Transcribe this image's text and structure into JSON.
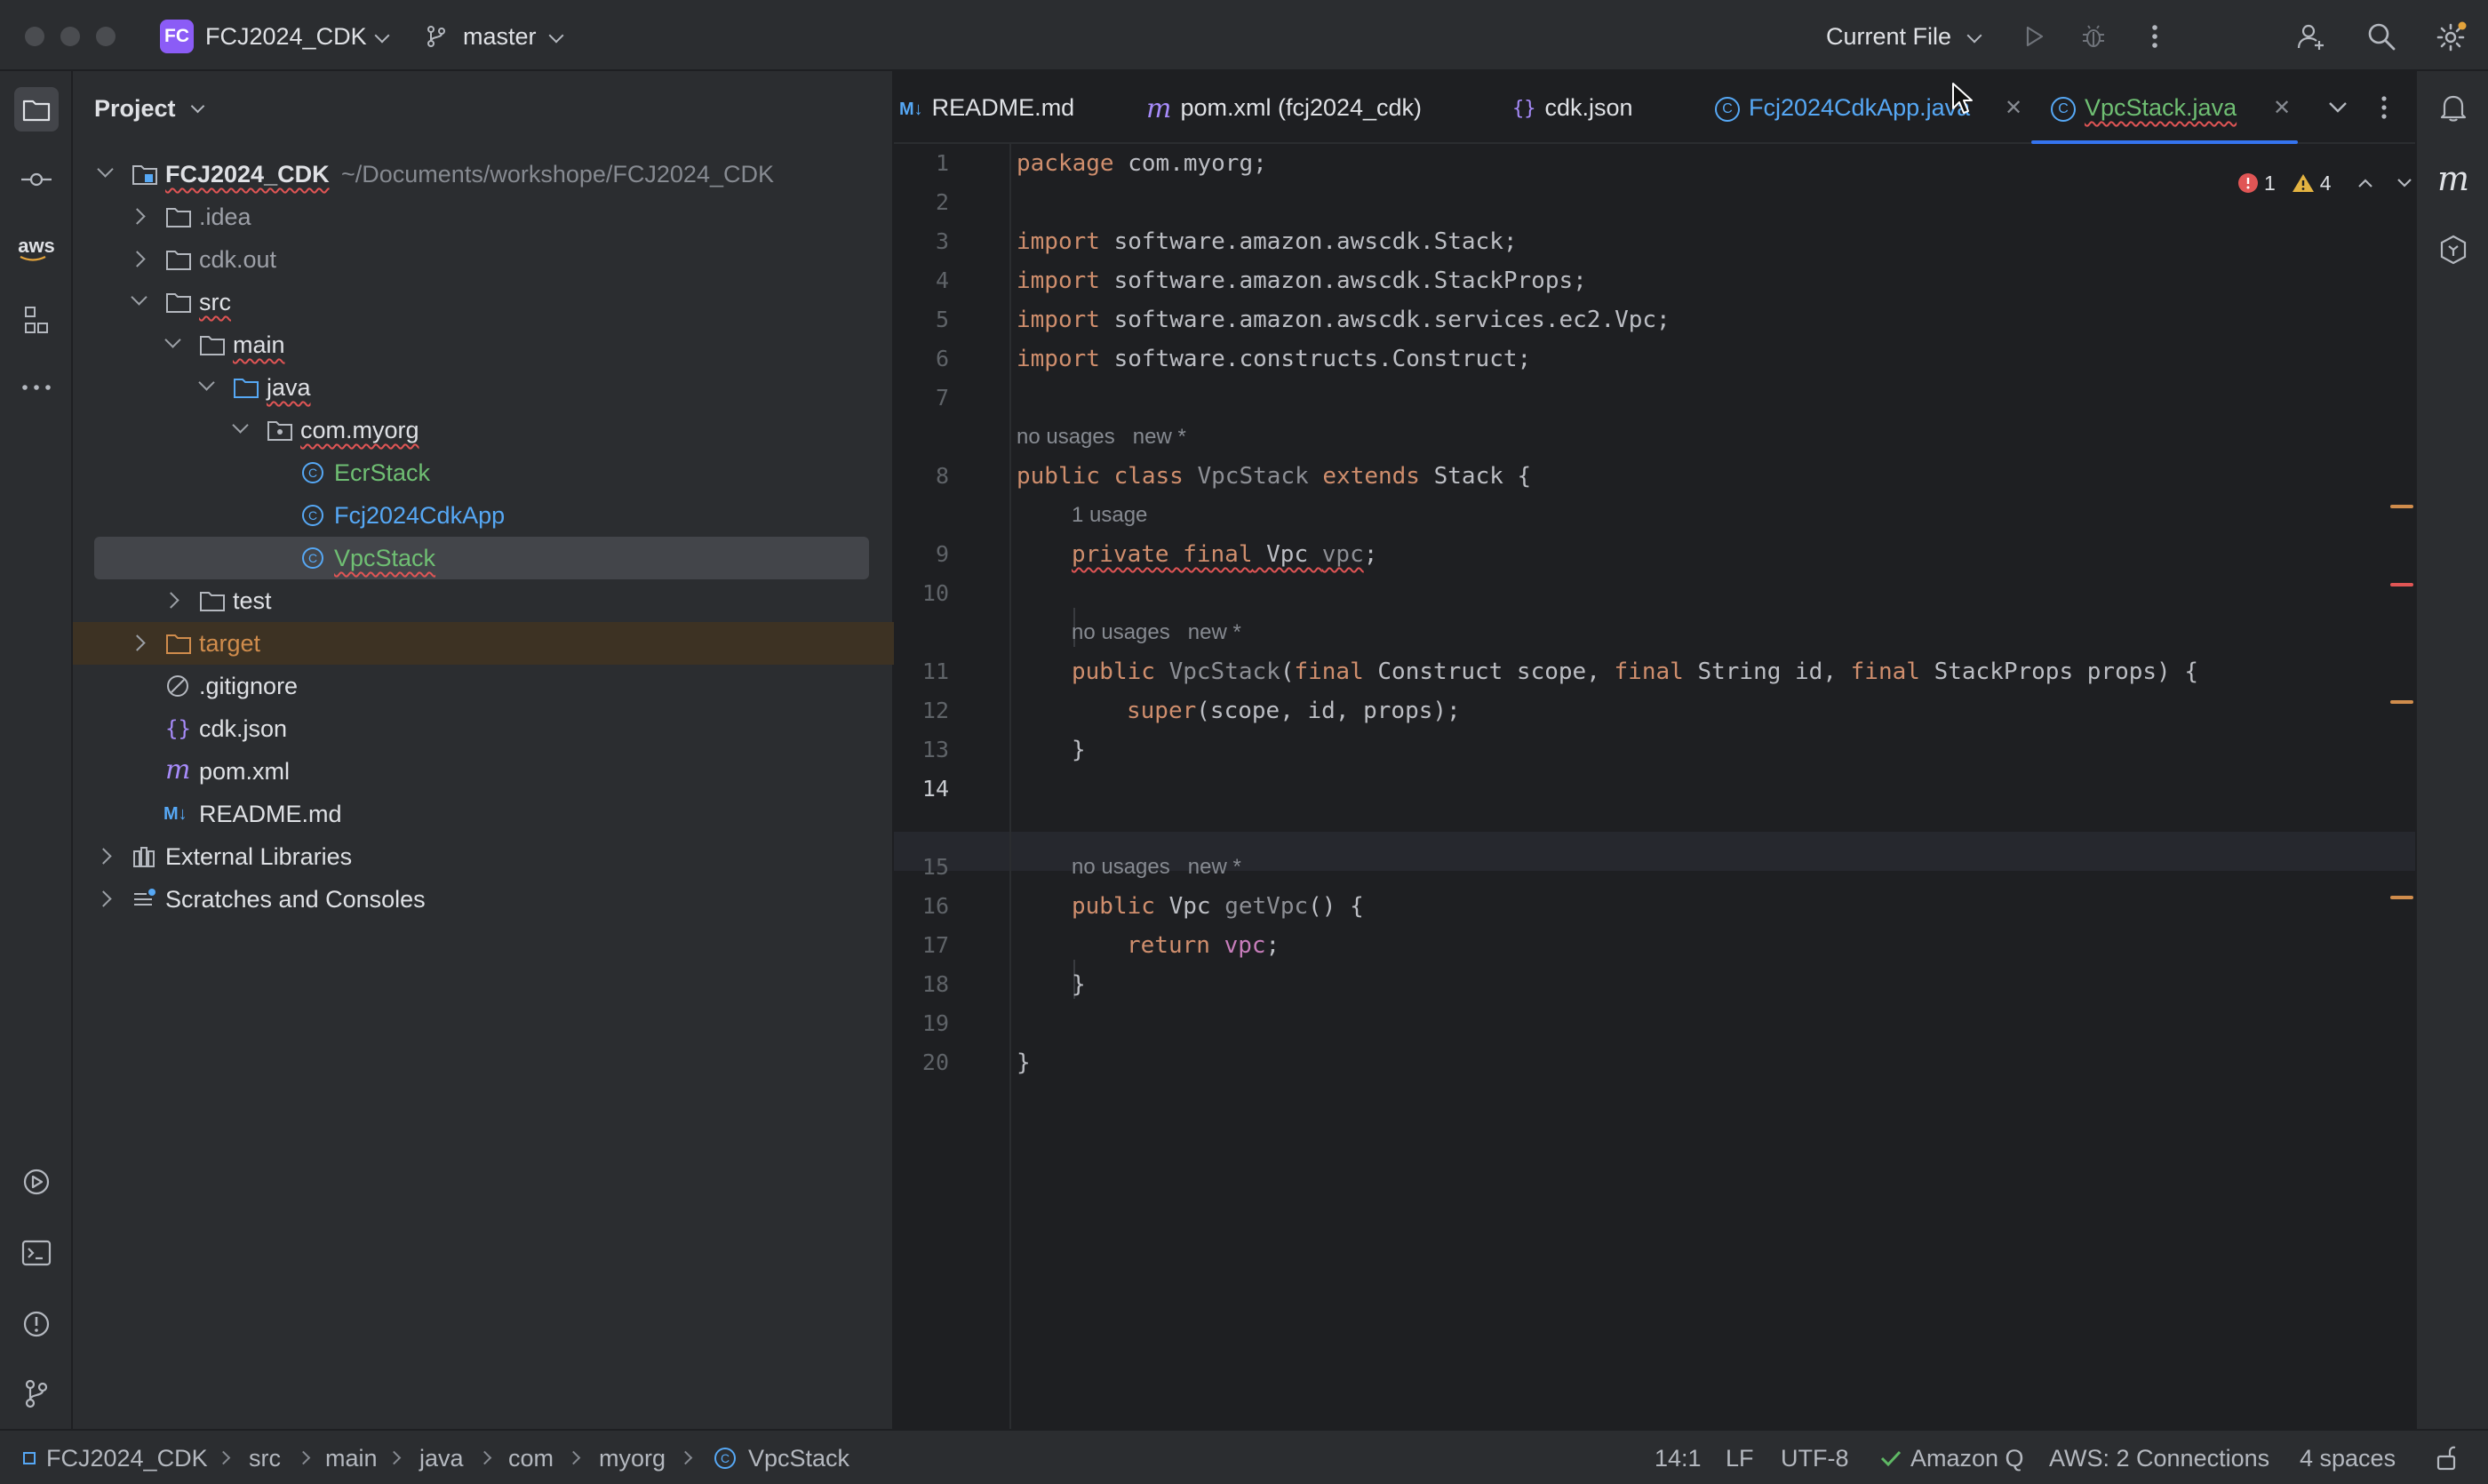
{
  "window": {
    "project_initials": "FC",
    "project_name": "FCJ2024_CDK",
    "branch": "master",
    "run_config": "Current File"
  },
  "left_strip": {
    "icons": [
      "folder-icon",
      "commit-icon",
      "aws-icon",
      "structure-icon",
      "more-icon",
      "services-icon",
      "terminal-icon",
      "problems-icon",
      "git-icon"
    ],
    "aws_label": "aws"
  },
  "project_panel": {
    "title": "Project",
    "root_name": "FCJ2024_CDK",
    "root_path": "~/Documents/workshope/FCJ2024_CDK",
    "items": [
      {
        "label": ".idea"
      },
      {
        "label": "cdk.out"
      },
      {
        "label": "src"
      },
      {
        "label": "main"
      },
      {
        "label": "java"
      },
      {
        "label": "com.myorg"
      },
      {
        "label": "EcrStack"
      },
      {
        "label": "Fcj2024CdkApp"
      },
      {
        "label": "VpcStack"
      },
      {
        "label": "test"
      },
      {
        "label": "target"
      },
      {
        "label": ".gitignore"
      },
      {
        "label": "cdk.json"
      },
      {
        "label": "pom.xml"
      },
      {
        "label": "README.md"
      },
      {
        "label": "External Libraries"
      },
      {
        "label": "Scratches and Consoles"
      }
    ]
  },
  "tabs": [
    {
      "label": "README.md",
      "icon": "markdown-icon",
      "icon_text": "M↓"
    },
    {
      "label": "pom.xml (fcj2024_cdk)",
      "icon": "maven-icon",
      "icon_text": "m"
    },
    {
      "label": "cdk.json",
      "icon": "json-icon",
      "icon_text": "{}"
    },
    {
      "label": "Fcj2024CdkApp.java",
      "icon": "class-icon",
      "icon_text": "C"
    },
    {
      "label": "VpcStack.java",
      "icon": "class-icon",
      "icon_text": "C"
    }
  ],
  "editor": {
    "error_count": "1",
    "warning_count": "4",
    "line_numbers": [
      "1",
      "2",
      "3",
      "4",
      "5",
      "6",
      "7",
      "8",
      "9",
      "10",
      "11",
      "12",
      "13",
      "14",
      "15",
      "16",
      "17",
      "18",
      "19",
      "20"
    ],
    "hints": {
      "h1a": "no usages",
      "h1b": "new *",
      "h2": "1 usage",
      "h3a": "no usages",
      "h3b": "new *",
      "h4a": "no usages",
      "h4b": "new *"
    },
    "code": {
      "l1_kw": "package",
      "l1_rest": " com.myorg;",
      "l3_kw": "import",
      "l3_rest": " software.amazon.awscdk.Stack;",
      "l4_kw": "import",
      "l4_rest": " software.amazon.awscdk.StackProps;",
      "l5_kw": "import",
      "l5_rest": " software.amazon.awscdk.services.ec2.Vpc;",
      "l6_kw": "import",
      "l6_rest": " software.constructs.Construct;",
      "l8_kw1": "public class",
      "l8_name": " VpcStack ",
      "l8_kw2": "extends",
      "l8_rest": " Stack {",
      "l9_kw": "private final",
      "l9_type": " Vpc ",
      "l9_fld": "vpc",
      "l9_end": ";",
      "l11_kw": "public",
      "l11_name": " VpcStack",
      "l11_p1": "(",
      "l11_f1": "final",
      "l11_a1": " Construct scope, ",
      "l11_f2": "final",
      "l11_a2": " String id, ",
      "l11_f3": "final",
      "l11_a3": " StackProps props) {",
      "l12_kw": "super",
      "l12_rest": "(scope, id, props);",
      "l13": "}",
      "l15_kw": "public",
      "l15_type": " Vpc ",
      "l15_name": "getVpc",
      "l15_rest": "() {",
      "l16_kw": "return",
      "l16_fld": " vpc",
      "l16_end": ";",
      "l17": "}",
      "l19": "}"
    }
  },
  "statusbar": {
    "crumbs": [
      "FCJ2024_CDK",
      "src",
      "main",
      "java",
      "com",
      "myorg",
      "VpcStack"
    ],
    "position": "14:1",
    "line_sep": "LF",
    "encoding": "UTF-8",
    "amazon_q": "Amazon Q",
    "aws": "AWS: 2 Connections",
    "indent": "4 spaces"
  },
  "colors": {
    "accent": "#3574f0",
    "green_file": "#6fbf73",
    "blue_file": "#56a8f5",
    "excluded": "#d08c4c",
    "error": "#e05555",
    "warning": "#e3b341"
  }
}
